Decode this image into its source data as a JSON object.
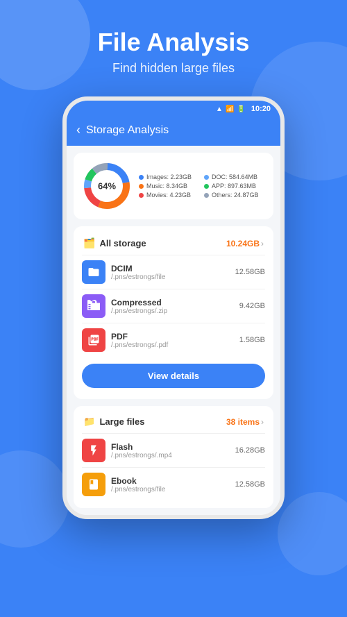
{
  "page": {
    "title": "File Analysis",
    "subtitle": "Find hidden large files",
    "background_color": "#3b82f6"
  },
  "status_bar": {
    "time": "10:20"
  },
  "app_header": {
    "title": "Storage Analysis",
    "back_label": "<"
  },
  "storage_chart": {
    "percentage": "64%",
    "legend": [
      {
        "label": "Images: 2.23GB",
        "color": "#3b82f6"
      },
      {
        "label": "DOC: 584.64MB",
        "color": "#3b82f6"
      },
      {
        "label": "Music: 8.34GB",
        "color": "#f97316"
      },
      {
        "label": "APP: 897.63MB",
        "color": "#22c55e"
      },
      {
        "label": "Movies: 4.23GB",
        "color": "#ef4444"
      },
      {
        "label": "Others: 24.87GB",
        "color": "#94a3b8"
      }
    ]
  },
  "all_storage": {
    "section_title": "All storage",
    "section_icon": "🗂️",
    "total_size": "10.24GB",
    "items": [
      {
        "name": "DCIM",
        "path": "/.pns/estrongs/file",
        "size": "12.58GB",
        "icon_color": "blue",
        "icon": "📁"
      },
      {
        "name": "Compressed",
        "path": "/.pns/estrongs/.zip",
        "size": "9.42GB",
        "icon_color": "purple",
        "icon": "🗜️"
      },
      {
        "name": "PDF",
        "path": "/.pns/estrongs/.pdf",
        "size": "1.58GB",
        "icon_color": "red",
        "icon": "📄"
      }
    ],
    "view_button": "View details"
  },
  "large_files": {
    "section_title": "Large files",
    "section_icon": "📁",
    "count": "38 items",
    "items": [
      {
        "name": "Flash",
        "path": "/.pns/estrongs/.mp4",
        "size": "16.28GB",
        "icon_color": "flash",
        "icon": "⚡"
      },
      {
        "name": "Ebook",
        "path": "/.pns/estrongs/file",
        "size": "12.58GB",
        "icon_color": "yellow",
        "icon": "📒"
      }
    ]
  }
}
